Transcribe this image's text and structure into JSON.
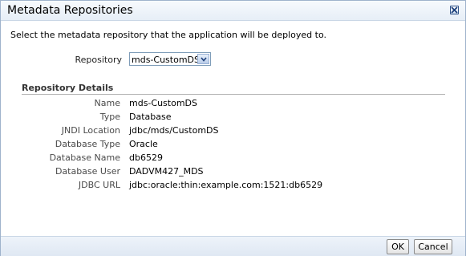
{
  "dialog": {
    "title": "Metadata Repositories",
    "close_icon": "close-icon"
  },
  "instruction": "Select the metadata repository that the application will be deployed to.",
  "repository_select": {
    "label": "Repository",
    "value": "mds-CustomDS",
    "arrow_icon": "chevron-down-icon"
  },
  "details": {
    "header": "Repository Details",
    "rows": [
      {
        "label": "Name",
        "value": "mds-CustomDS"
      },
      {
        "label": "Type",
        "value": "Database"
      },
      {
        "label": "JNDI Location",
        "value": "jdbc/mds/CustomDS"
      },
      {
        "label": "Database Type",
        "value": "Oracle"
      },
      {
        "label": "Database Name",
        "value": "db6529"
      },
      {
        "label": "Database User",
        "value": "DADVM427_MDS"
      },
      {
        "label": "JDBC URL",
        "value": "jdbc:oracle:thin:example.com:1521:db6529"
      }
    ]
  },
  "buttons": {
    "ok_label": "OK",
    "cancel_label": "Cancel"
  }
}
